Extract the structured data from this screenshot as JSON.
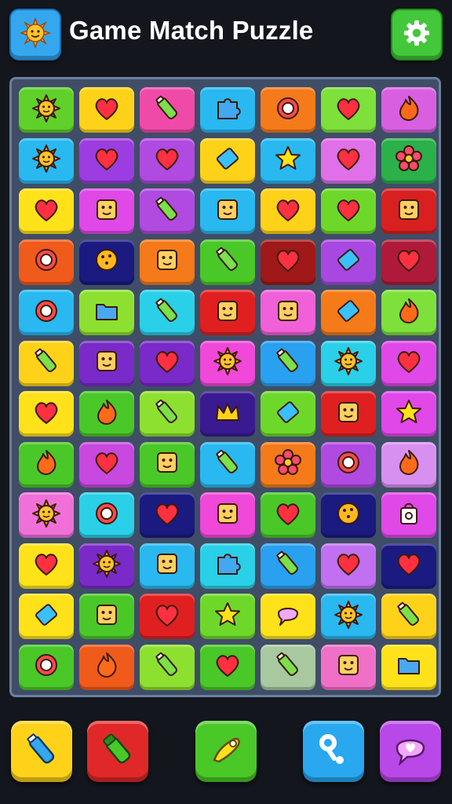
{
  "header": {
    "title": "Game Match Puzzle",
    "logo_icon": "sun-icon",
    "settings_icon": "gear-icon"
  },
  "board": {
    "rows": [
      [
        {
          "c": "#5fd12a",
          "i": "sun"
        },
        {
          "c": "#ffd21a",
          "i": "heart"
        },
        {
          "c": "#f04aa8",
          "i": "bottle"
        },
        {
          "c": "#29b8f0",
          "i": "puzzle"
        },
        {
          "c": "#f47a1a",
          "i": "ring"
        },
        {
          "c": "#7ee03a",
          "i": "heart"
        },
        {
          "c": "#d860e0",
          "i": "flame"
        }
      ],
      [
        {
          "c": "#29b8f0",
          "i": "sun"
        },
        {
          "c": "#9b3de0",
          "i": "heart"
        },
        {
          "c": "#b04ae0",
          "i": "heart"
        },
        {
          "c": "#ffd21a",
          "i": "gem"
        },
        {
          "c": "#29b8f0",
          "i": "star"
        },
        {
          "c": "#e070e8",
          "i": "heart"
        },
        {
          "c": "#2bb04a",
          "i": "flower"
        }
      ],
      [
        {
          "c": "#ffe21a",
          "i": "heart"
        },
        {
          "c": "#e048e8",
          "i": "face"
        },
        {
          "c": "#b04ae0",
          "i": "bottle"
        },
        {
          "c": "#29b8f0",
          "i": "face"
        },
        {
          "c": "#ffd21a",
          "i": "heart"
        },
        {
          "c": "#6ed82a",
          "i": "heart"
        },
        {
          "c": "#d82020",
          "i": "face"
        }
      ],
      [
        {
          "c": "#f05a1a",
          "i": "ring"
        },
        {
          "c": "#1a1a80",
          "i": "cookie"
        },
        {
          "c": "#f47a1a",
          "i": "face"
        },
        {
          "c": "#4ac828",
          "i": "bottle"
        },
        {
          "c": "#a01818",
          "i": "heart"
        },
        {
          "c": "#a848e0",
          "i": "gem"
        },
        {
          "c": "#b01a3a",
          "i": "heart"
        }
      ],
      [
        {
          "c": "#29b8f0",
          "i": "ring"
        },
        {
          "c": "#8ee030",
          "i": "folder"
        },
        {
          "c": "#2ad0e8",
          "i": "bottle"
        },
        {
          "c": "#e02020",
          "i": "face"
        },
        {
          "c": "#f060d8",
          "i": "face"
        },
        {
          "c": "#f47a1a",
          "i": "gem"
        },
        {
          "c": "#7ee03a",
          "i": "flame"
        }
      ],
      [
        {
          "c": "#ffd21a",
          "i": "bottle"
        },
        {
          "c": "#7a2ac8",
          "i": "face"
        },
        {
          "c": "#7a2ac8",
          "i": "heart"
        },
        {
          "c": "#f048d8",
          "i": "sun"
        },
        {
          "c": "#29a0f0",
          "i": "bottle"
        },
        {
          "c": "#2ad0e8",
          "i": "sun"
        },
        {
          "c": "#e048e8",
          "i": "heart"
        }
      ],
      [
        {
          "c": "#ffe21a",
          "i": "heart"
        },
        {
          "c": "#4ac828",
          "i": "flame"
        },
        {
          "c": "#8ee030",
          "i": "bottle"
        },
        {
          "c": "#3a1a90",
          "i": "crown"
        },
        {
          "c": "#6ed82a",
          "i": "gem"
        },
        {
          "c": "#e02020",
          "i": "face"
        },
        {
          "c": "#e048e8",
          "i": "star"
        }
      ],
      [
        {
          "c": "#4ac828",
          "i": "flame"
        },
        {
          "c": "#c848e0",
          "i": "heart"
        },
        {
          "c": "#4ac828",
          "i": "face"
        },
        {
          "c": "#29b8f0",
          "i": "bottle"
        },
        {
          "c": "#f47a1a",
          "i": "flower"
        },
        {
          "c": "#b04ae0",
          "i": "ring"
        },
        {
          "c": "#d890f0",
          "i": "flame"
        }
      ],
      [
        {
          "c": "#f070d8",
          "i": "sun"
        },
        {
          "c": "#2ad0e8",
          "i": "ring"
        },
        {
          "c": "#1a1a80",
          "i": "heart"
        },
        {
          "c": "#f048d8",
          "i": "face"
        },
        {
          "c": "#4ac828",
          "i": "heart"
        },
        {
          "c": "#1a1a80",
          "i": "cookie"
        },
        {
          "c": "#e048e8",
          "i": "bag"
        }
      ],
      [
        {
          "c": "#ffe21a",
          "i": "heart"
        },
        {
          "c": "#7a2ac8",
          "i": "sun"
        },
        {
          "c": "#29b8f0",
          "i": "face"
        },
        {
          "c": "#2ad0e8",
          "i": "puzzle"
        },
        {
          "c": "#29a0f0",
          "i": "bottle"
        },
        {
          "c": "#c070f0",
          "i": "heart"
        },
        {
          "c": "#1a1a80",
          "i": "heart"
        }
      ],
      [
        {
          "c": "#ffe21a",
          "i": "gem"
        },
        {
          "c": "#4ac828",
          "i": "face"
        },
        {
          "c": "#e02020",
          "i": "heart"
        },
        {
          "c": "#6ed82a",
          "i": "star"
        },
        {
          "c": "#ffe21a",
          "i": "bubble"
        },
        {
          "c": "#29b8f0",
          "i": "sun"
        },
        {
          "c": "#ffd21a",
          "i": "bottle"
        }
      ],
      [
        {
          "c": "#4ac828",
          "i": "ring"
        },
        {
          "c": "#f05a1a",
          "i": "flame"
        },
        {
          "c": "#8ee030",
          "i": "bottle"
        },
        {
          "c": "#4ac828",
          "i": "heart"
        },
        {
          "c": "#a8c8a0",
          "i": "bottle"
        },
        {
          "c": "#f070c8",
          "i": "face"
        },
        {
          "c": "#ffe21a",
          "i": "folder"
        }
      ]
    ]
  },
  "powerups": [
    {
      "name": "powerup-bottle",
      "color": "#ffd21a",
      "icon": "bottle-icon"
    },
    {
      "name": "powerup-tube",
      "color": "#e02828",
      "icon": "tube-icon"
    },
    {
      "name": "powerup-rocket",
      "color": "#4ac828",
      "icon": "rocket-icon"
    },
    {
      "name": "powerup-link",
      "color": "#29a8f0",
      "icon": "link-icon"
    },
    {
      "name": "powerup-bubble",
      "color": "#b848e8",
      "icon": "bubble-icon"
    }
  ]
}
